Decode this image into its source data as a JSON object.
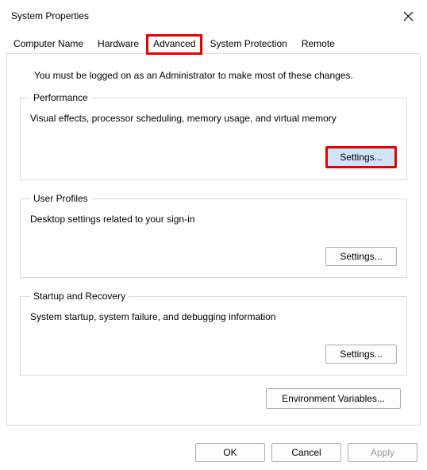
{
  "window": {
    "title": "System Properties"
  },
  "tabs": {
    "computer_name": "Computer Name",
    "hardware": "Hardware",
    "advanced": "Advanced",
    "system_protection": "System Protection",
    "remote": "Remote",
    "active": "advanced"
  },
  "intro_text": "You must be logged on as an Administrator to make most of these changes.",
  "groups": {
    "performance": {
      "legend": "Performance",
      "desc": "Visual effects, processor scheduling, memory usage, and virtual memory",
      "button": "Settings..."
    },
    "user_profiles": {
      "legend": "User Profiles",
      "desc": "Desktop settings related to your sign-in",
      "button": "Settings..."
    },
    "startup_recovery": {
      "legend": "Startup and Recovery",
      "desc": "System startup, system failure, and debugging information",
      "button": "Settings..."
    }
  },
  "env_button": "Environment Variables...",
  "footer": {
    "ok": "OK",
    "cancel": "Cancel",
    "apply": "Apply"
  }
}
